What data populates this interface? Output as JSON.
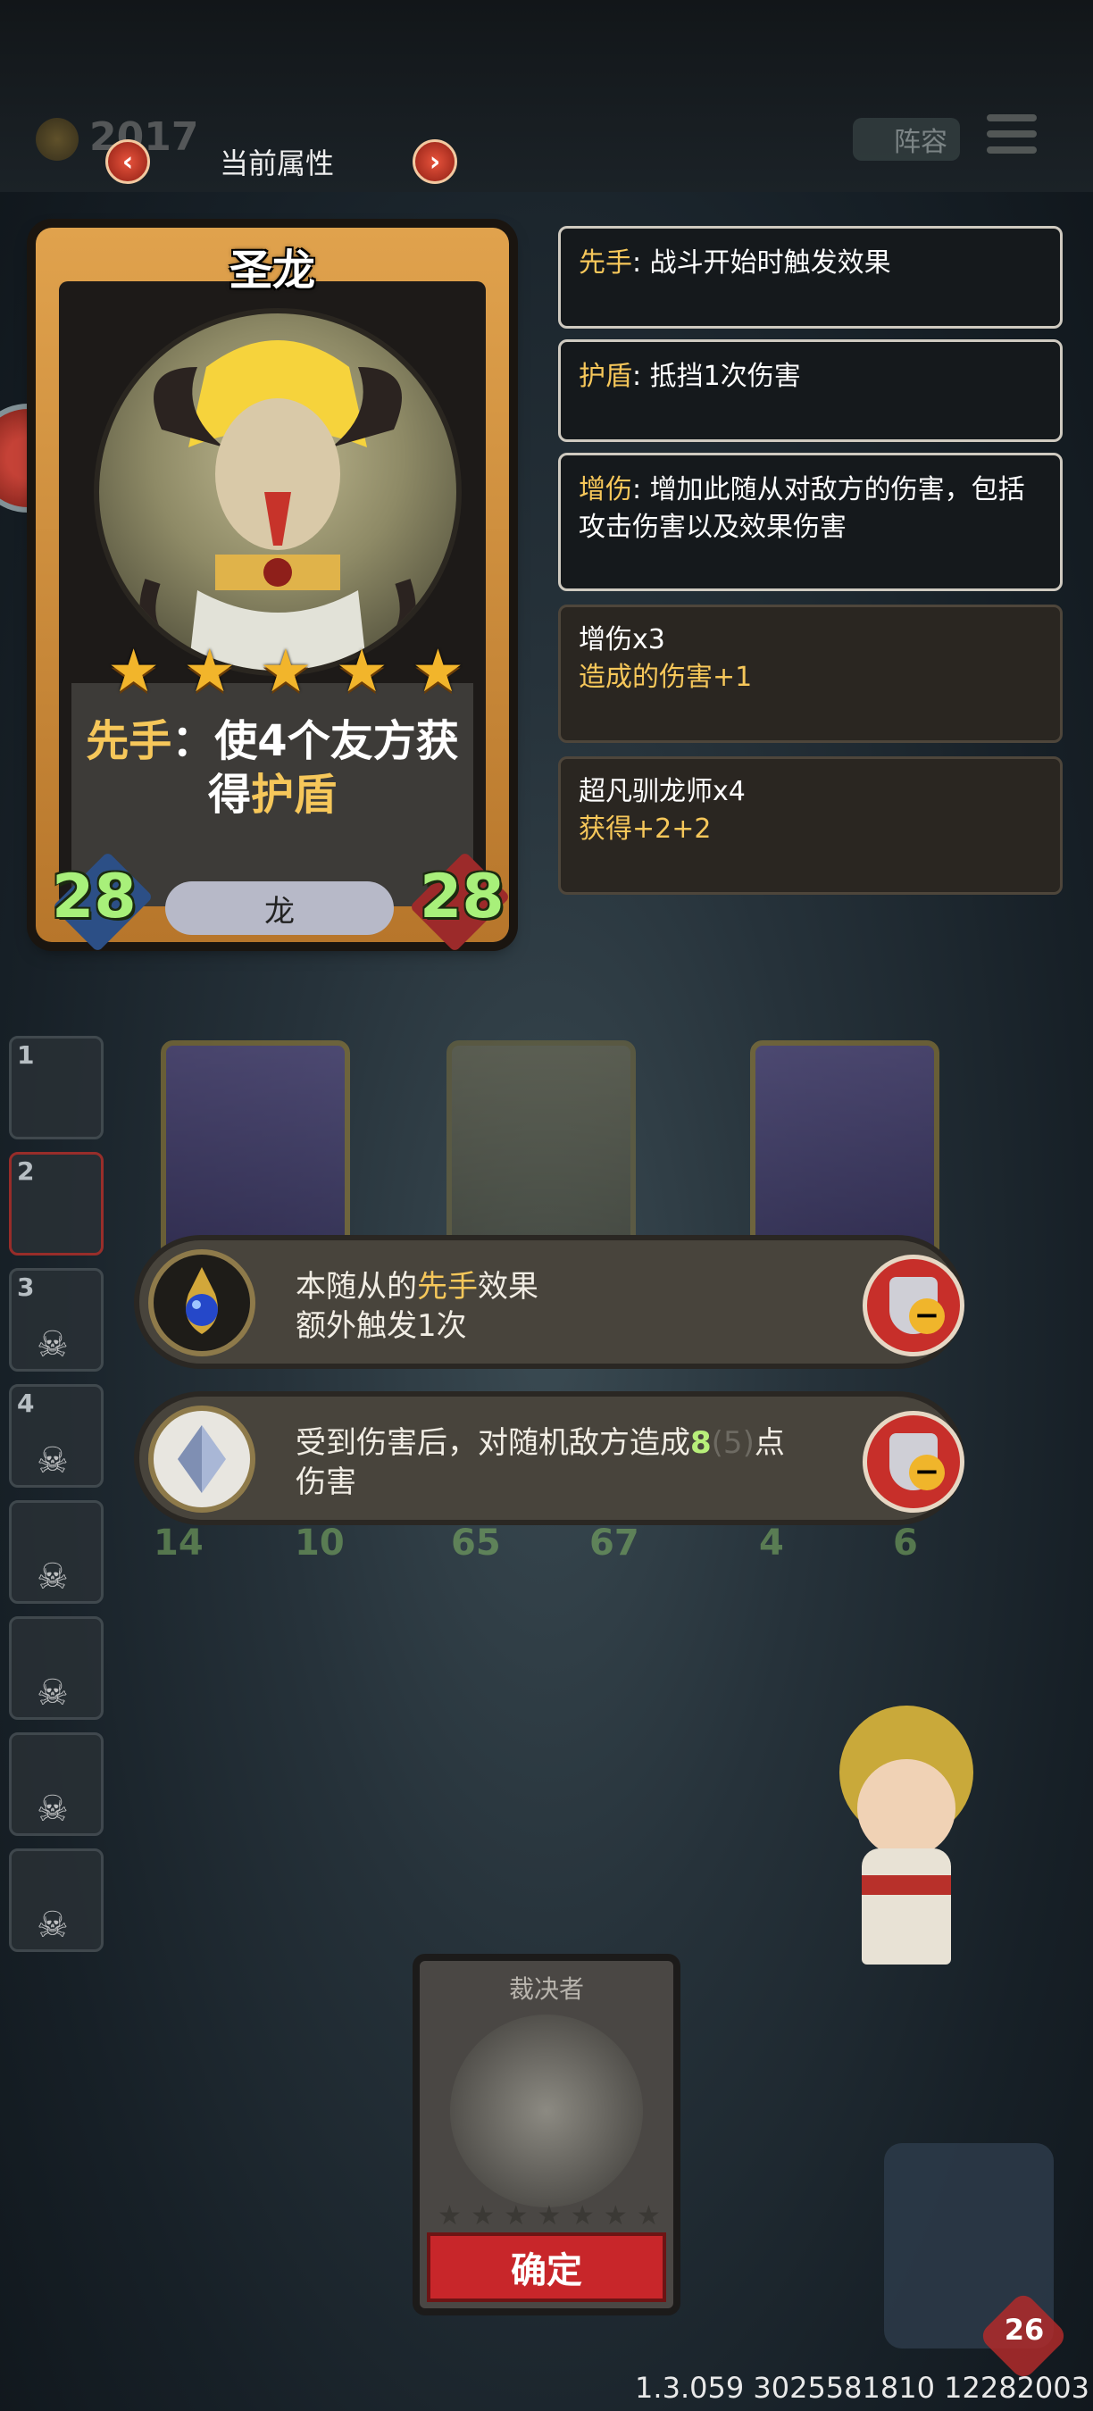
{
  "header": {
    "coin_value": "2017",
    "title": "当前属性",
    "prev_icon": "chevron-left-icon",
    "next_icon": "chevron-right-icon",
    "lineup_label": "阵容"
  },
  "card": {
    "name": "圣龙",
    "stars": 5,
    "ability_prefix": "先手",
    "ability_mid": "：使",
    "ability_num": "4",
    "ability_mid2": "个友方获得",
    "ability_kw": "护盾",
    "attack": "28",
    "health": "28",
    "tribe": "龙"
  },
  "keywords": [
    {
      "term": "先手",
      "desc": ": 战斗开始时触发效果"
    },
    {
      "term": "护盾",
      "desc": ": 抵挡1次伤害"
    },
    {
      "term": "增伤",
      "desc": ": 增加此随从对敌方的伤害，包括攻击伤害以及效果伤害"
    }
  ],
  "bonuses": [
    {
      "title": "增伤x3",
      "detail": "造成的伤害+1"
    },
    {
      "title": "超凡驯龙师x4",
      "detail": "获得+2+2"
    }
  ],
  "sidebar_slots": [
    "1",
    "2",
    "3",
    "4",
    "",
    "",
    "",
    ""
  ],
  "board_stats": {
    "card1": {
      "atk": "14",
      "hp": "10"
    },
    "card2": {
      "atk": "65",
      "hp": "67"
    },
    "card3": {
      "atk": "4",
      "hp": "6"
    }
  },
  "effects": [
    {
      "icon": "blue-orb-icon",
      "line1_a": "本随从的",
      "line1_kw": "先手",
      "line1_b": "效果",
      "line2": "额外触发1次"
    },
    {
      "icon": "crystal-icon",
      "text_a": "受到伤害后，对随机敌方造成",
      "value": "8",
      "base": "(5)",
      "text_b": "点",
      "line2": "伤害"
    }
  ],
  "bottom_card": {
    "title": "裁决者",
    "stars": 7,
    "confirm_label": "确定"
  },
  "player": {
    "hp": "26"
  },
  "version": "1.3.059 3025581810 12282003",
  "colors": {
    "highlight": "#f6c75a",
    "stat_green": "#a8f07a",
    "confirm_red": "#c8262a"
  }
}
